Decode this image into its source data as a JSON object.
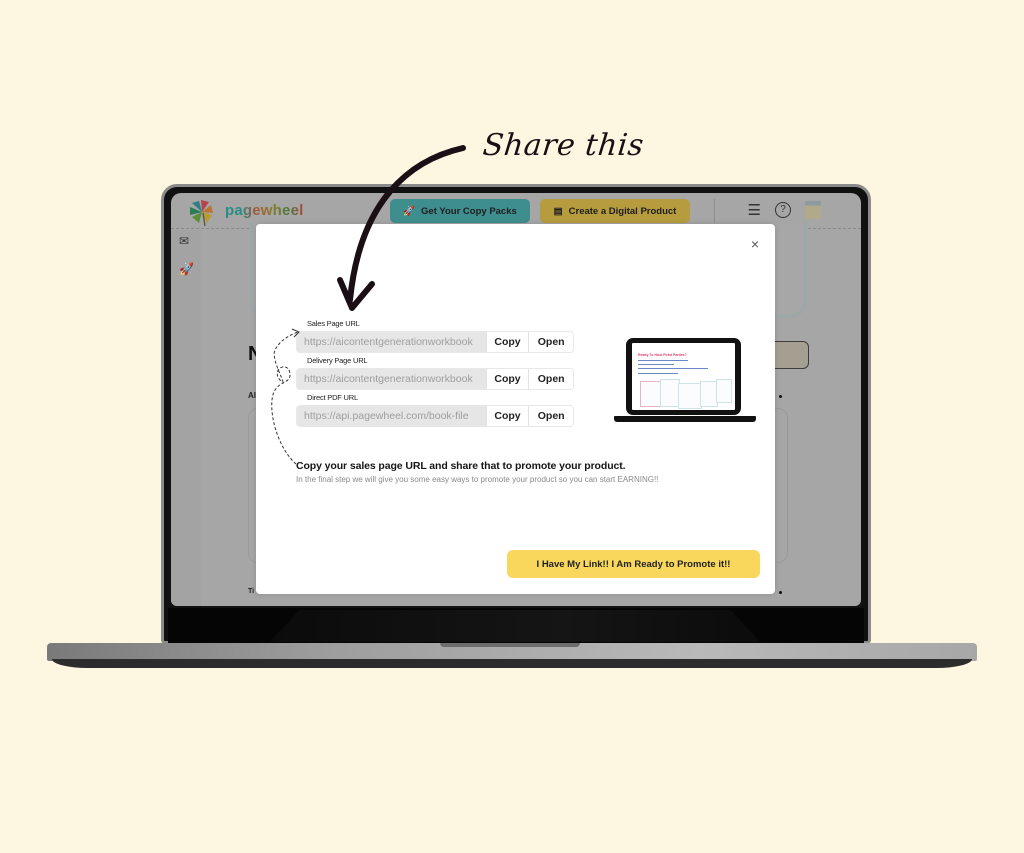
{
  "annotation": {
    "text": "Share this"
  },
  "app": {
    "logo_text": "pagewheel",
    "header": {
      "copy_packs_label": "Get Your Copy Packs",
      "create_product_label": "Create a Digital Product",
      "icons": [
        "list-icon",
        "help-icon",
        "calendar-icon"
      ]
    },
    "sidebar": {
      "icons": [
        "mail-icon",
        "rocket-icon"
      ]
    },
    "background": {
      "heading_fragment": "N",
      "sub_fragment": "Al",
      "footer_fragment": "Ti"
    }
  },
  "modal": {
    "close_label": "×",
    "fields": [
      {
        "label": "Sales Page URL",
        "value": "https://aicontentgenerationworkbook",
        "copy_label": "Copy",
        "open_label": "Open"
      },
      {
        "label": "Delivery Page URL",
        "value": "https://aicontentgenerationworkbook",
        "copy_label": "Copy",
        "open_label": "Open"
      },
      {
        "label": "Direct PDF URL",
        "value": "https://api.pagewheel.com/book-file",
        "copy_label": "Copy",
        "open_label": "Open"
      }
    ],
    "preview": {
      "title": "Ready To Host Point Parties?"
    },
    "message": "Copy your sales page URL and share that to promote your product.",
    "submessage": "In the final step we will give you some easy ways to promote your product so you can start EARNING!!",
    "cta_label": "I Have My Link!! I Am Ready to Promote it!!"
  },
  "colors": {
    "page_bg": "#fdf6e1",
    "cta_yellow": "#f8d75c",
    "teal_button": "#3f8e8e",
    "gold_button": "#b69c3f"
  }
}
